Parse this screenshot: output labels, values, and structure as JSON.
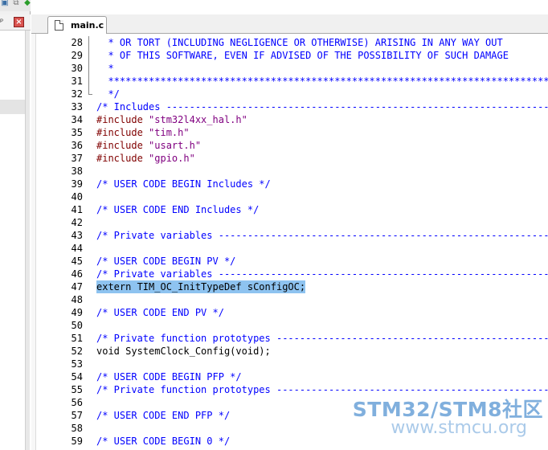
{
  "colors": {
    "comment": "#0000ff",
    "preprocessor": "#800000",
    "string": "#800080",
    "plain": "#000000",
    "highlight": "#8ec3f0",
    "watermark": "#6aa2d8"
  },
  "toolbar": {
    "icons": [
      "window-icon",
      "copy-icon",
      "green-diamond-icon",
      "arrow-icon",
      "grid-icon"
    ]
  },
  "panel": {
    "pin_glyph": "ᵖ",
    "close_glyph": "×"
  },
  "tabs": [
    {
      "label": "main.c",
      "active": true,
      "icon": "file-icon"
    }
  ],
  "editor": {
    "lines": [
      {
        "num": "28",
        "text": "  * OR TORT (INCLUDING NEGLIGENCE OR OTHERWISE) ARISING IN ANY WAY OUT",
        "kind": "comment",
        "fold": "mid"
      },
      {
        "num": "29",
        "text": "  * OF THIS SOFTWARE, EVEN IF ADVISED OF THE POSSIBILITY OF SUCH DAMAGE",
        "kind": "comment",
        "fold": "mid"
      },
      {
        "num": "30",
        "text": "  *",
        "kind": "comment",
        "fold": "mid"
      },
      {
        "num": "31",
        "text": "  ****************************************************************************",
        "kind": "comment",
        "fold": "mid"
      },
      {
        "num": "32",
        "text": "  */",
        "kind": "comment",
        "fold": "end"
      },
      {
        "num": "33",
        "text": "/* Includes ------------------------------------------------------------------",
        "kind": "comment",
        "fold": ""
      },
      {
        "num": "34",
        "pre": "#include ",
        "str": "\"stm32l4xx_hal.h\"",
        "kind": "include",
        "fold": ""
      },
      {
        "num": "35",
        "pre": "#include ",
        "str": "\"tim.h\"",
        "kind": "include",
        "fold": ""
      },
      {
        "num": "36",
        "pre": "#include ",
        "str": "\"usart.h\"",
        "kind": "include",
        "fold": ""
      },
      {
        "num": "37",
        "pre": "#include ",
        "str": "\"gpio.h\"",
        "kind": "include",
        "fold": ""
      },
      {
        "num": "38",
        "text": "",
        "kind": "plain",
        "fold": ""
      },
      {
        "num": "39",
        "text": "/* USER CODE BEGIN Includes */",
        "kind": "comment",
        "fold": ""
      },
      {
        "num": "40",
        "text": "",
        "kind": "plain",
        "fold": ""
      },
      {
        "num": "41",
        "text": "/* USER CODE END Includes */",
        "kind": "comment",
        "fold": ""
      },
      {
        "num": "42",
        "text": "",
        "kind": "plain",
        "fold": ""
      },
      {
        "num": "43",
        "text": "/* Private variables ---------------------------------------------------------",
        "kind": "comment",
        "fold": ""
      },
      {
        "num": "44",
        "text": "",
        "kind": "plain",
        "fold": ""
      },
      {
        "num": "45",
        "text": "/* USER CODE BEGIN PV */",
        "kind": "comment",
        "fold": ""
      },
      {
        "num": "46",
        "text": "/* Private variables ---------------------------------------------------------",
        "kind": "comment",
        "fold": ""
      },
      {
        "num": "47",
        "text": "extern TIM_OC_InitTypeDef sConfigOC;",
        "kind": "plain",
        "fold": "",
        "highlight": true
      },
      {
        "num": "48",
        "text": "",
        "kind": "plain",
        "fold": ""
      },
      {
        "num": "49",
        "text": "/* USER CODE END PV */",
        "kind": "comment",
        "fold": ""
      },
      {
        "num": "50",
        "text": "",
        "kind": "plain",
        "fold": ""
      },
      {
        "num": "51",
        "text": "/* Private function prototypes -----------------------------------------------",
        "kind": "comment",
        "fold": ""
      },
      {
        "num": "52",
        "text": "void SystemClock_Config(void);",
        "kind": "plain",
        "fold": ""
      },
      {
        "num": "53",
        "text": "",
        "kind": "plain",
        "fold": ""
      },
      {
        "num": "54",
        "text": "/* USER CODE BEGIN PFP */",
        "kind": "comment",
        "fold": ""
      },
      {
        "num": "55",
        "text": "/* Private function prototypes -----------------------------------------------",
        "kind": "comment",
        "fold": ""
      },
      {
        "num": "56",
        "text": "",
        "kind": "plain",
        "fold": ""
      },
      {
        "num": "57",
        "text": "/* USER CODE END PFP */",
        "kind": "comment",
        "fold": ""
      },
      {
        "num": "58",
        "text": "",
        "kind": "plain",
        "fold": ""
      },
      {
        "num": "59",
        "text": "/* USER CODE BEGIN 0 */",
        "kind": "comment",
        "fold": ""
      }
    ]
  },
  "watermark": {
    "title": "STM32/STM8社区",
    "url": "www.stmcu.org"
  }
}
